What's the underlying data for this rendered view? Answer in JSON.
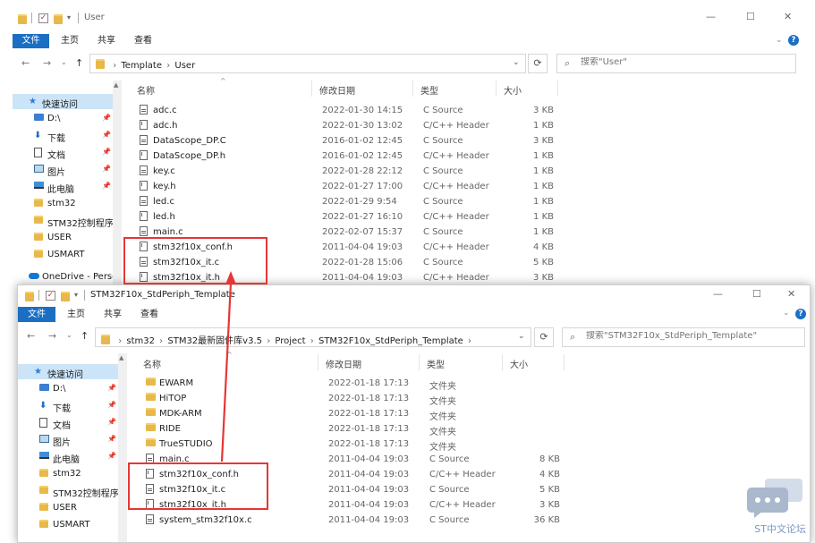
{
  "window1": {
    "title": "User",
    "tabs": [
      "文件",
      "主页",
      "共享",
      "查看"
    ],
    "breadcrumbs": [
      "Template",
      "User"
    ],
    "search_placeholder": "搜索\"User\"",
    "nav": [
      {
        "label": "快速访问",
        "icon": "star-icon",
        "top": true,
        "selected": true
      },
      {
        "label": "D:\\",
        "icon": "drive-icon",
        "pin": true
      },
      {
        "label": "下载",
        "icon": "download-icon",
        "pin": true
      },
      {
        "label": "文档",
        "icon": "document-icon",
        "pin": true
      },
      {
        "label": "图片",
        "icon": "picture-icon",
        "pin": true
      },
      {
        "label": "此电脑",
        "icon": "computer-icon",
        "pin": true
      },
      {
        "label": "stm32",
        "icon": "folder-icon"
      },
      {
        "label": "STM32控制程序",
        "icon": "folder-icon"
      },
      {
        "label": "USER",
        "icon": "folder-icon"
      },
      {
        "label": "USMART",
        "icon": "folder-icon"
      },
      {
        "label": "OneDrive - Perso",
        "icon": "onedrive-icon",
        "top": true
      }
    ],
    "columns": [
      "名称",
      "修改日期",
      "类型",
      "大小"
    ],
    "files": [
      {
        "name": "adc.c",
        "date": "2022-01-30 14:15",
        "type": "C Source",
        "size": "3 KB",
        "kind": "c"
      },
      {
        "name": "adc.h",
        "date": "2022-01-30 13:02",
        "type": "C/C++ Header",
        "size": "1 KB",
        "kind": "h"
      },
      {
        "name": "DataScope_DP.C",
        "date": "2016-01-02 12:45",
        "type": "C Source",
        "size": "3 KB",
        "kind": "c"
      },
      {
        "name": "DataScope_DP.h",
        "date": "2016-01-02 12:45",
        "type": "C/C++ Header",
        "size": "1 KB",
        "kind": "h"
      },
      {
        "name": "key.c",
        "date": "2022-01-28 22:12",
        "type": "C Source",
        "size": "1 KB",
        "kind": "c"
      },
      {
        "name": "key.h",
        "date": "2022-01-27 17:00",
        "type": "C/C++ Header",
        "size": "1 KB",
        "kind": "h"
      },
      {
        "name": "led.c",
        "date": "2022-01-29 9:54",
        "type": "C Source",
        "size": "1 KB",
        "kind": "c"
      },
      {
        "name": "led.h",
        "date": "2022-01-27 16:10",
        "type": "C/C++ Header",
        "size": "1 KB",
        "kind": "h"
      },
      {
        "name": "main.c",
        "date": "2022-02-07 15:37",
        "type": "C Source",
        "size": "1 KB",
        "kind": "c"
      },
      {
        "name": "stm32f10x_conf.h",
        "date": "2011-04-04 19:03",
        "type": "C/C++ Header",
        "size": "4 KB",
        "kind": "h"
      },
      {
        "name": "stm32f10x_it.c",
        "date": "2022-01-28 15:06",
        "type": "C Source",
        "size": "5 KB",
        "kind": "c"
      },
      {
        "name": "stm32f10x_it.h",
        "date": "2011-04-04 19:03",
        "type": "C/C++ Header",
        "size": "3 KB",
        "kind": "h"
      }
    ]
  },
  "window2": {
    "title": "STM32F10x_StdPeriph_Template",
    "tabs": [
      "文件",
      "主页",
      "共享",
      "查看"
    ],
    "breadcrumbs": [
      "stm32",
      "STM32最新固件库v3.5",
      "Project",
      "STM32F10x_StdPeriph_Template"
    ],
    "search_placeholder": "搜索\"STM32F10x_StdPeriph_Template\"",
    "nav": [
      {
        "label": "快速访问",
        "icon": "star-icon",
        "top": true,
        "selected": true
      },
      {
        "label": "D:\\",
        "icon": "drive-icon",
        "pin": true
      },
      {
        "label": "下载",
        "icon": "download-icon",
        "pin": true
      },
      {
        "label": "文档",
        "icon": "document-icon",
        "pin": true
      },
      {
        "label": "图片",
        "icon": "picture-icon",
        "pin": true
      },
      {
        "label": "此电脑",
        "icon": "computer-icon",
        "pin": true
      },
      {
        "label": "stm32",
        "icon": "folder-icon"
      },
      {
        "label": "STM32控制程序",
        "icon": "folder-icon"
      },
      {
        "label": "USER",
        "icon": "folder-icon"
      },
      {
        "label": "USMART",
        "icon": "folder-icon"
      }
    ],
    "columns": [
      "名称",
      "修改日期",
      "类型",
      "大小"
    ],
    "files": [
      {
        "name": "EWARM",
        "date": "2022-01-18 17:13",
        "type": "文件夹",
        "size": "",
        "kind": "folder"
      },
      {
        "name": "HiTOP",
        "date": "2022-01-18 17:13",
        "type": "文件夹",
        "size": "",
        "kind": "folder"
      },
      {
        "name": "MDK-ARM",
        "date": "2022-01-18 17:13",
        "type": "文件夹",
        "size": "",
        "kind": "folder"
      },
      {
        "name": "RIDE",
        "date": "2022-01-18 17:13",
        "type": "文件夹",
        "size": "",
        "kind": "folder"
      },
      {
        "name": "TrueSTUDIO",
        "date": "2022-01-18 17:13",
        "type": "文件夹",
        "size": "",
        "kind": "folder"
      },
      {
        "name": "main.c",
        "date": "2011-04-04 19:03",
        "type": "C Source",
        "size": "8 KB",
        "kind": "c"
      },
      {
        "name": "stm32f10x_conf.h",
        "date": "2011-04-04 19:03",
        "type": "C/C++ Header",
        "size": "4 KB",
        "kind": "h"
      },
      {
        "name": "stm32f10x_it.c",
        "date": "2011-04-04 19:03",
        "type": "C Source",
        "size": "5 KB",
        "kind": "c"
      },
      {
        "name": "stm32f10x_it.h",
        "date": "2011-04-04 19:03",
        "type": "C/C++ Header",
        "size": "3 KB",
        "kind": "h"
      },
      {
        "name": "system_stm32f10x.c",
        "date": "2011-04-04 19:03",
        "type": "C Source",
        "size": "36 KB",
        "kind": "c"
      }
    ]
  },
  "watermark": "ST中文论坛",
  "colors": {
    "accent": "#1a6fc3",
    "highlight": "#e63636",
    "selected": "#cce4f7"
  }
}
